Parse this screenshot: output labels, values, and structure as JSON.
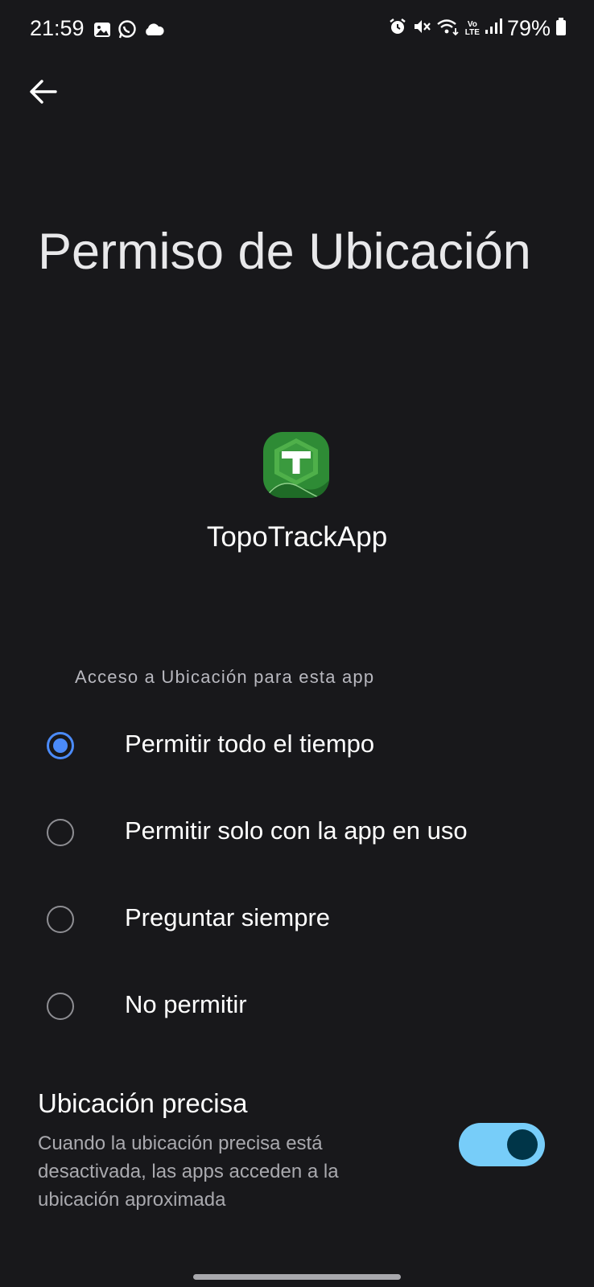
{
  "status_bar": {
    "time": "21:59",
    "battery": "79%",
    "left_icons": [
      "gallery-icon",
      "whatsapp-icon",
      "cloud-icon"
    ],
    "right_icons": [
      "alarm-icon",
      "mute-icon",
      "wifi-icon",
      "volte-icon",
      "signal-icon",
      "battery-icon"
    ],
    "volte_text_top": "Vo",
    "volte_text_bottom": "LTE"
  },
  "header": {
    "back_icon": "arrow-left-icon",
    "title": "Permiso de Ubicación"
  },
  "app": {
    "name": "TopoTrackApp",
    "icon": "topotrack-app-icon",
    "icon_color": "#2e8b35",
    "icon_letter": "T"
  },
  "location_access": {
    "section_label": "Acceso a Ubicación para esta app",
    "selected_index": 0,
    "options": [
      {
        "label": "Permitir todo el tiempo",
        "selected": true
      },
      {
        "label": "Permitir solo con la app en uso",
        "selected": false
      },
      {
        "label": "Preguntar siempre",
        "selected": false
      },
      {
        "label": "No permitir",
        "selected": false
      }
    ]
  },
  "precise_location": {
    "title": "Ubicación precisa",
    "description": "Cuando la ubicación precisa está desactivada, las apps acceden a la ubicación aproximada",
    "enabled": true
  },
  "colors": {
    "background": "#18181b",
    "accent": "#4b8bfa",
    "toggle_track": "#77cdf9",
    "toggle_knob": "#003548"
  }
}
